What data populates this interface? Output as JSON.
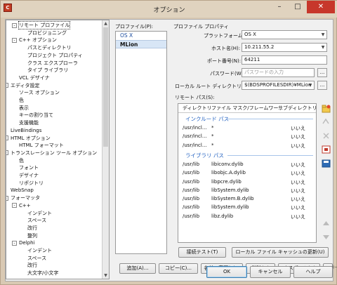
{
  "window": {
    "title": "オプション"
  },
  "tree": [
    {
      "label": "リモート プロファイル",
      "level": 1,
      "exp": "-",
      "selected": true
    },
    {
      "label": "プロビジョニング",
      "level": 2
    },
    {
      "label": "C++ オプション",
      "level": 1,
      "exp": "-"
    },
    {
      "label": "パスとディレクトリ",
      "level": 2
    },
    {
      "label": "プロジェクト プロパティ",
      "level": 2
    },
    {
      "label": "クラス エクスプローラ",
      "level": 2
    },
    {
      "label": "タイプ ライブラリ",
      "level": 2
    },
    {
      "label": "VCL デザイナ",
      "level": 1
    },
    {
      "label": "エディタ設定",
      "level": 0,
      "exp": "-"
    },
    {
      "label": "ソース オプション",
      "level": 1
    },
    {
      "label": "色",
      "level": 1
    },
    {
      "label": "表示",
      "level": 1
    },
    {
      "label": "キーの割り当て",
      "level": 1
    },
    {
      "label": "支援機能",
      "level": 1
    },
    {
      "label": "LiveBindings",
      "level": 0
    },
    {
      "label": "HTML オプション",
      "level": 0,
      "exp": "-"
    },
    {
      "label": "HTML フォーマット",
      "level": 1
    },
    {
      "label": "トランスレーション ツール オプション",
      "level": 0,
      "exp": "-"
    },
    {
      "label": "色",
      "level": 1
    },
    {
      "label": "フォント",
      "level": 1
    },
    {
      "label": "デザイナ",
      "level": 1
    },
    {
      "label": "リポジトリ",
      "level": 1
    },
    {
      "label": "WebSnap",
      "level": 0
    },
    {
      "label": "フォーマッタ",
      "level": 0,
      "exp": "-"
    },
    {
      "label": "C++",
      "level": 1,
      "exp": "-"
    },
    {
      "label": "インデント",
      "level": 2
    },
    {
      "label": "スペース",
      "level": 2
    },
    {
      "label": "改行",
      "level": 2
    },
    {
      "label": "整列",
      "level": 2
    },
    {
      "label": "Delphi",
      "level": 1,
      "exp": "-"
    },
    {
      "label": "インデント",
      "level": 2
    },
    {
      "label": "スペース",
      "level": 2
    },
    {
      "label": "改行",
      "level": 2
    },
    {
      "label": "大文字/小文字",
      "level": 2
    }
  ],
  "profiles": {
    "label": "プロファイル(P):",
    "items": [
      "OS X",
      "MLion"
    ],
    "selected_index": 1
  },
  "props": {
    "group_label": "プロファイル プロパティ",
    "platform_label": "プラットフォーム(F):",
    "platform_value": "OS X",
    "host_label": "ホスト名(H):",
    "host_value": "10.211.55.2",
    "port_label": "ポート番号(N):",
    "port_value": "64211",
    "password_label": "パスワード(W):",
    "password_placeholder": "パスワードの入力",
    "root_label": "ローカル ルート ディレクトリ(L):",
    "root_value": "$(BDSPROFILESDIR)¥MLion",
    "browse": "..."
  },
  "paths": {
    "label": "リモート パス(S):",
    "columns": [
      "ディレクトリ",
      "ファイル マスク/フレームワー...",
      "サブディレクトリ"
    ],
    "include_title": "インクルード パス",
    "include_rows": [
      {
        "dir": "/usr/incl...",
        "mask": "*",
        "sub": "いいえ"
      },
      {
        "dir": "/usr/incl...",
        "mask": "*",
        "sub": "いいえ"
      },
      {
        "dir": "/usr/incl...",
        "mask": "*",
        "sub": "いいえ"
      }
    ],
    "library_title": "ライブラリ パス",
    "library_rows": [
      {
        "dir": "/usr/lib",
        "mask": "libiconv.dylib",
        "sub": "いいえ"
      },
      {
        "dir": "/usr/lib",
        "mask": "libobjc.A.dylib",
        "sub": "いいえ"
      },
      {
        "dir": "/usr/lib",
        "mask": "libpcre.dylib",
        "sub": "いいえ"
      },
      {
        "dir": "/usr/lib",
        "mask": "libSystem.dylib",
        "sub": "いいえ"
      },
      {
        "dir": "/usr/lib",
        "mask": "libSystem.B.dylib",
        "sub": "いいえ"
      },
      {
        "dir": "/usr/lib",
        "mask": "libSystem.dylib",
        "sub": "いいえ"
      },
      {
        "dir": "/usr/lib",
        "mask": "libz.dylib",
        "sub": "いいえ"
      }
    ]
  },
  "buttons": {
    "test": "接続テスト(T)",
    "clear_cache": "ローカル ファイル キャッシュの更新(U)",
    "add": "追加(A)...",
    "copy": "コピー(C)...",
    "rename": "名前の変更(E)...",
    "delete": "削除(D)",
    "export": "エクスポート(X)...",
    "import": "インポート(I)...",
    "ok": "OK",
    "cancel": "キャンセル",
    "help": "ヘルプ"
  },
  "colors": {
    "accent": "#1f5fc0",
    "close": "#c7372b"
  }
}
